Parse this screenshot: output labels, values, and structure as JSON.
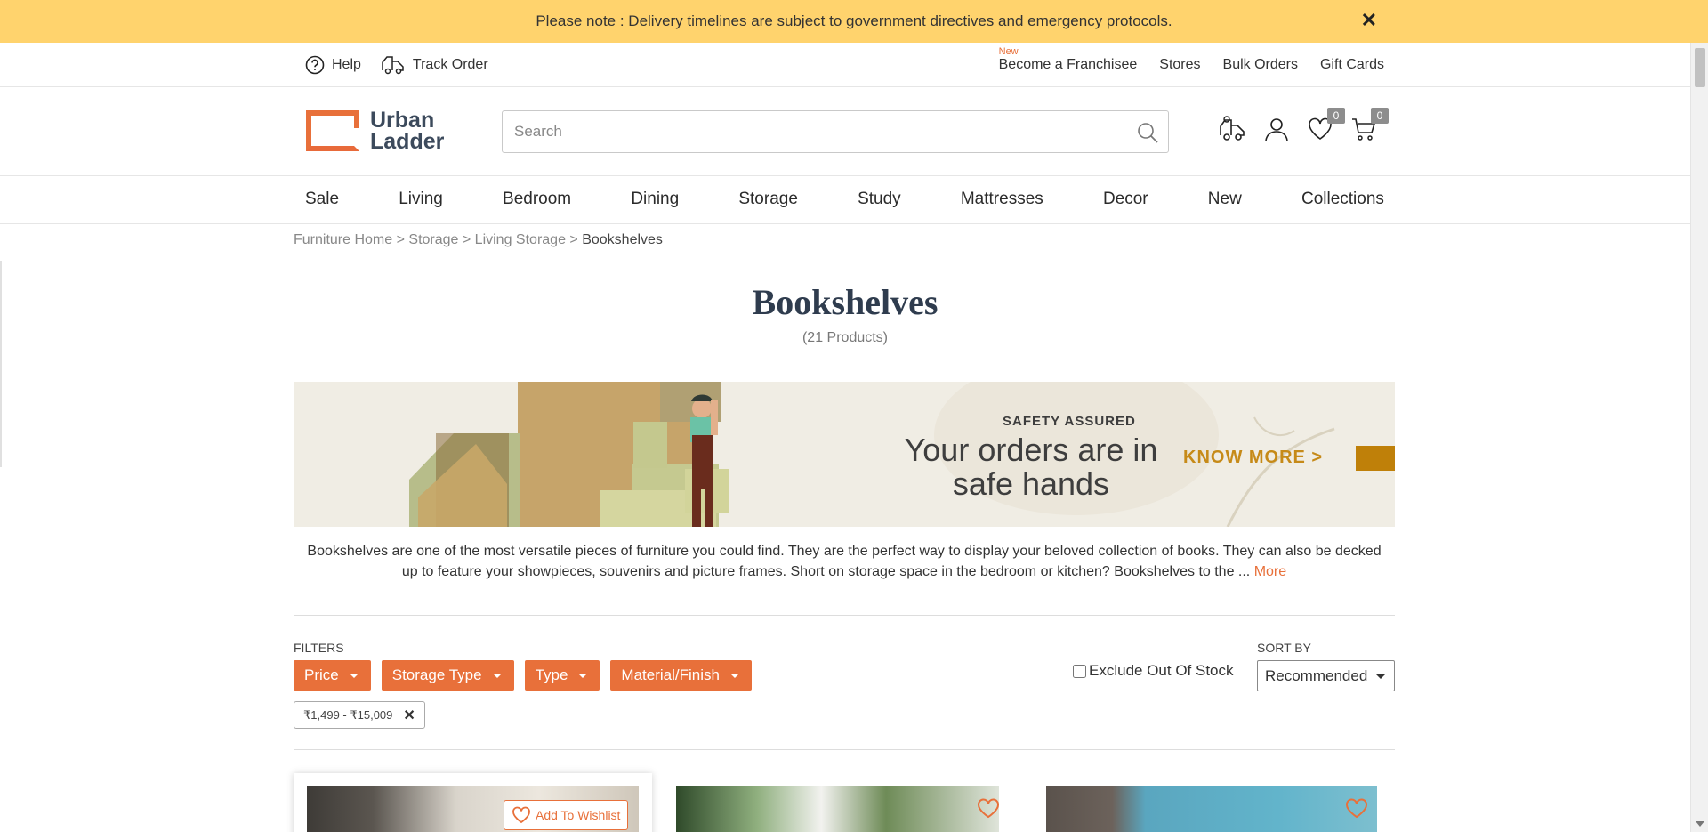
{
  "notice": {
    "text": "Please note : Delivery timelines are subject to government directives and emergency protocols.",
    "close": "✕"
  },
  "util": {
    "help": "Help",
    "track": "Track Order",
    "new_tag": "New",
    "links": [
      "Become a Franchisee",
      "Stores",
      "Bulk Orders",
      "Gift Cards"
    ]
  },
  "header": {
    "logo_line1": "Urban",
    "logo_line2": "Ladder",
    "search_placeholder": "Search",
    "wishlist_count": "0",
    "cart_count": "0"
  },
  "nav": [
    "Sale",
    "Living",
    "Bedroom",
    "Dining",
    "Storage",
    "Study",
    "Mattresses",
    "Decor",
    "New",
    "Collections"
  ],
  "breadcrumb": {
    "items": [
      "Furniture Home",
      "Storage",
      "Living Storage"
    ],
    "current": "Bookshelves",
    "sep": " > "
  },
  "page": {
    "title": "Bookshelves",
    "count": "(21 Products)"
  },
  "banner": {
    "tag": "SAFETY ASSURED",
    "line1": "Your orders are in",
    "line2": "safe hands",
    "cta": "KNOW MORE >"
  },
  "description": {
    "text": "Bookshelves are one of the most versatile pieces of furniture you could find. They are the perfect way to display your beloved collection of books. They can also be decked up to feature your showpieces, souvenirs and picture frames. Short on storage space in the bedroom or kitchen? Bookshelves to the ... ",
    "more": "More"
  },
  "filters": {
    "label": "FILTERS",
    "buttons": [
      "Price",
      "Storage Type",
      "Type",
      "Material/Finish"
    ],
    "exclude_label": "Exclude Out Of Stock",
    "sort_label": "SORT BY",
    "sort_value": "Recommended",
    "chip": "₹1,499 - ₹15,009",
    "chip_close": "✕"
  },
  "products": {
    "wishlist_label": "Add To Wishlist"
  },
  "colors": {
    "accent": "#e8703a",
    "notice_bg": "#ffd36d",
    "title": "#2f3c4e"
  }
}
